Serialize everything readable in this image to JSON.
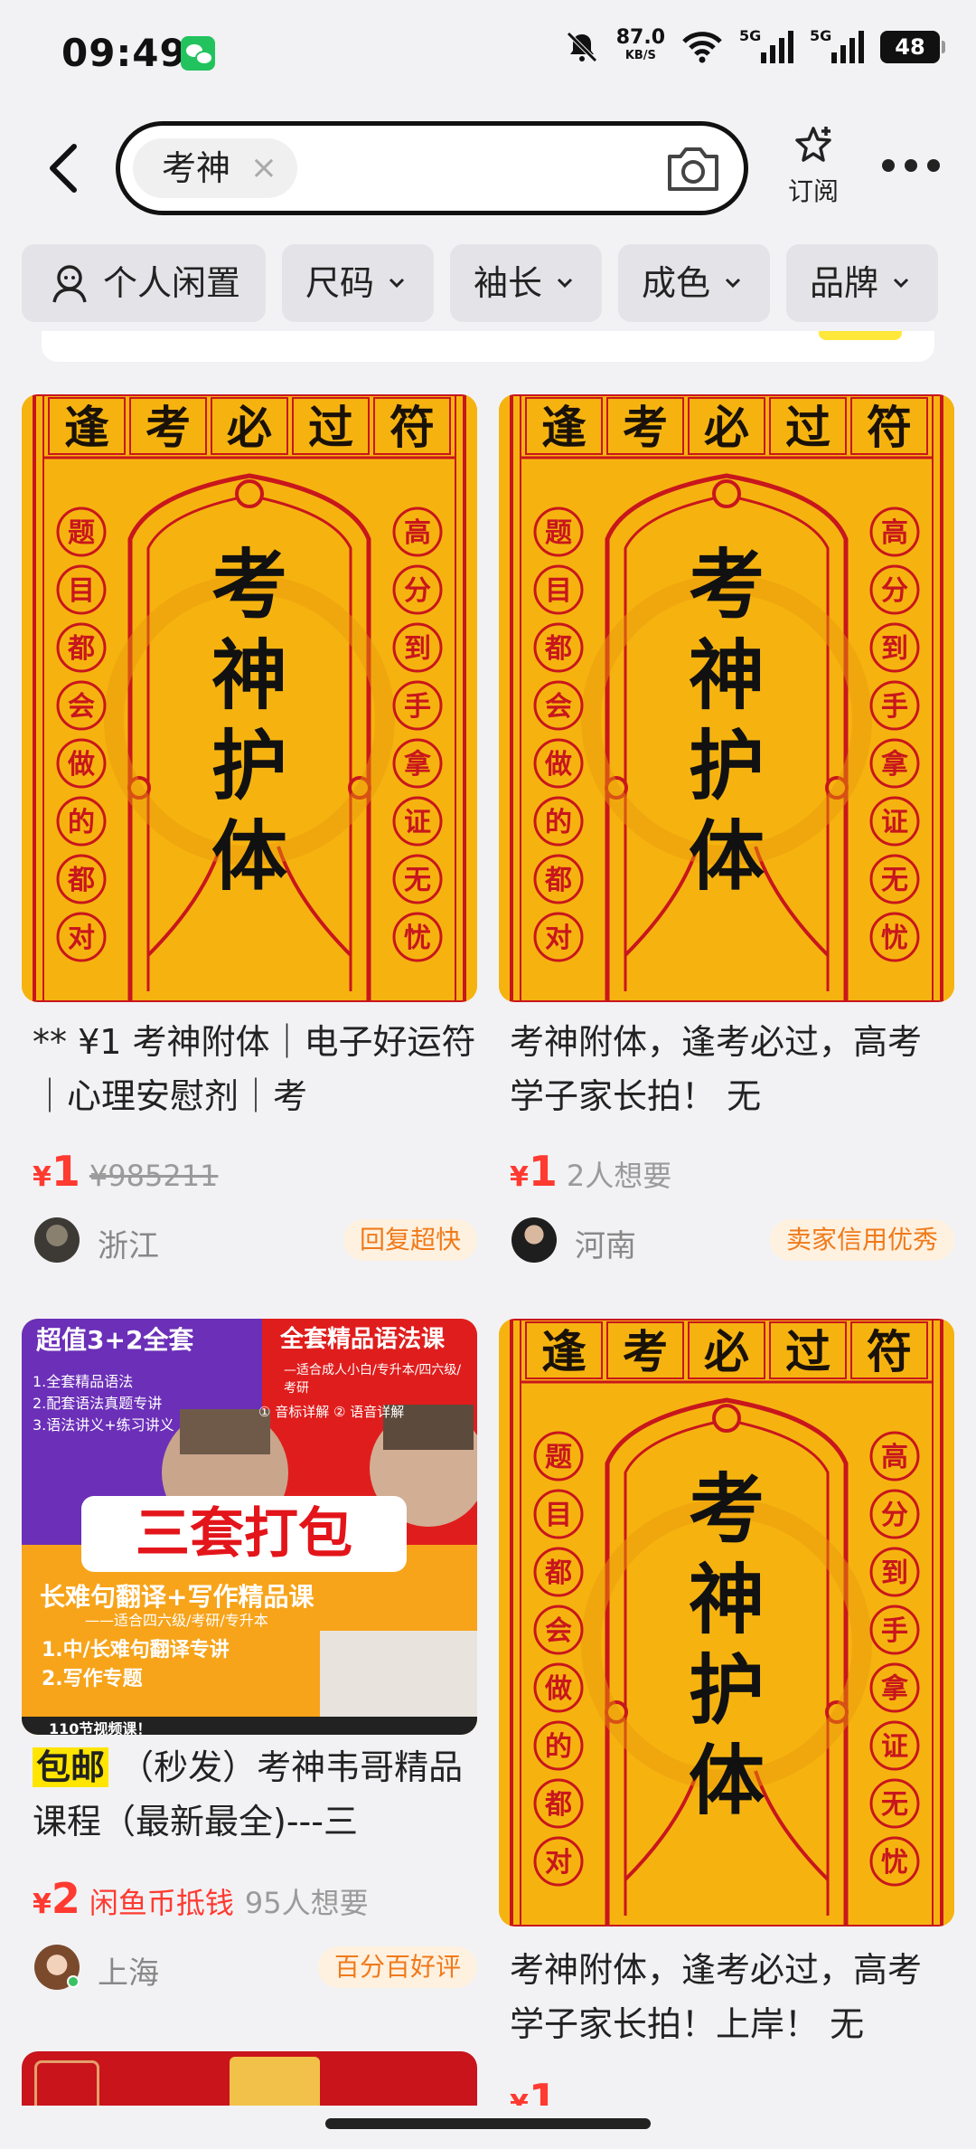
{
  "status_bar": {
    "time": "09:49",
    "net_speed": "87.0",
    "net_unit": "KB/S",
    "sig1": "5G",
    "sig2": "5G",
    "battery": "48"
  },
  "header": {
    "search_chip": "考神",
    "subscribe_label": "订阅"
  },
  "filters": [
    "个人闲置",
    "尺码",
    "袖长",
    "成色",
    "品牌"
  ],
  "talisman": {
    "title_chars": [
      "逢",
      "考",
      "必",
      "过",
      "符"
    ],
    "center_chars": [
      "考",
      "神",
      "护",
      "体"
    ],
    "left_chars": [
      "题",
      "目",
      "都",
      "会",
      "做",
      "的",
      "都",
      "对"
    ],
    "right_chars": [
      "高",
      "分",
      "到",
      "手",
      "拿",
      "证",
      "无",
      "忧"
    ]
  },
  "course_image": {
    "top_left": "超值3+2全套",
    "top_right": "全套精品语法课",
    "list": [
      "1.全套精品语法",
      "2.配套语法真题专讲",
      "3.语法讲义+练习讲义"
    ],
    "sub_right": "—适合成人小白/专升本/四六级/考研",
    "pills": "① 音标详解  ② 语音详解",
    "big": "三套打包",
    "band": "长难句翻译+写作精品课",
    "band_sub": "——适合四六级/考研/专升本",
    "item1": "1.中/长难句翻译专讲",
    "item2": "2.写作专题",
    "bottom": "110节视频课！"
  },
  "cards": [
    {
      "title": "** ¥1 考神附体｜电子好运符｜心理安慰剂｜考",
      "yen": "¥",
      "price": "1",
      "original_price": "¥985211",
      "location": "浙江",
      "badge": "回复超快"
    },
    {
      "title": "考神附体，逢考必过，高考学子家长拍！ 无",
      "yen": "¥",
      "price": "1",
      "want": "2人想要",
      "location": "河南",
      "badge": "卖家信用优秀"
    },
    {
      "tag": "包邮",
      "title": "（秒发）考神韦哥精品课程（最新最全)---三",
      "yen": "¥",
      "price": "2",
      "coin": "闲鱼币抵钱",
      "want": "95人想要",
      "location": "上海",
      "badge": "百分百好评"
    },
    {
      "title": "考神附体，逢考必过，高考学子家长拍！上岸！ 无",
      "yen": "¥",
      "price": "1"
    }
  ],
  "colors": {
    "price_red": "#ff3a30",
    "badge_orange": "#f07a1a",
    "talisman_gold": "#f6b310",
    "talisman_red": "#c8161d",
    "tag_yellow": "#ffe500"
  }
}
